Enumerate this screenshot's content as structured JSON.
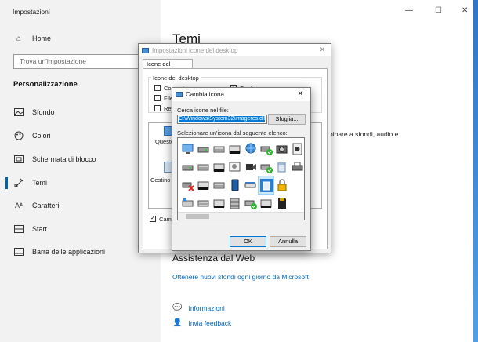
{
  "settings": {
    "app_title": "Impostazioni",
    "home_label": "Home",
    "search_placeholder": "Trova un'impostazione",
    "section_label": "Personalizzazione",
    "nav_items": [
      {
        "label": "Sfondo",
        "icon": "image-icon"
      },
      {
        "label": "Colori",
        "icon": "palette-icon"
      },
      {
        "label": "Schermata di blocco",
        "icon": "lock-screen-icon"
      },
      {
        "label": "Temi",
        "icon": "themes-icon"
      },
      {
        "label": "Caratteri",
        "icon": "font-icon"
      },
      {
        "label": "Start",
        "icon": "start-icon"
      },
      {
        "label": "Barra delle applicazioni",
        "icon": "taskbar-icon"
      }
    ],
    "active_item": "Temi",
    "main_title": "Temi",
    "partial_text": "binare a sfondi, audio e",
    "assistance_title": "Assistenza dal Web",
    "web_link": "Ottenere nuovi sfondi ogni giorno da Microsoft",
    "info_link": "Informazioni",
    "feedback_link": "Invia feedback",
    "partial_button": "ica"
  },
  "desktop_icons_dialog": {
    "title": "Impostazioni icone del desktop",
    "tab": "Icone del desktop",
    "group_label": "Icone del desktop",
    "checkboxes": [
      {
        "label": "Computer",
        "checked": false
      },
      {
        "label": "File",
        "checked": false
      },
      {
        "label": "Rete",
        "checked": false
      },
      {
        "label": "Cestino",
        "checked": true
      }
    ],
    "preview_labels": [
      "Questo",
      "Cestino ("
    ],
    "allow_themes_checkbox": {
      "label": "Cambia",
      "checked": true
    }
  },
  "change_icon_dialog": {
    "title": "Cambia icona",
    "file_label": "Cerca icone nel file:",
    "file_value": "C:\\Windows\\System32\\imageres.dll",
    "browse_button": "Sfoglia...",
    "list_label": "Selezionare un'icona dal seguente elenco:",
    "icon_names": [
      "monitor-icon",
      "drive-icon",
      "hdd-icon",
      "dvd-rw-icon",
      "globe-network-icon",
      "drive-check-icon",
      "camera-icon",
      "media-icon",
      "drive-icon",
      "hdd-icon",
      "dvd-r-icon",
      "photo-drive-icon",
      "camcorder-icon",
      "drive-green-check-icon",
      "trash-icon",
      "printer-icon",
      "drive-red-x-icon",
      "dvd-ram-icon",
      "hdd-icon",
      "phone-icon",
      "scanner-icon",
      "recycle-bin-full-icon",
      "padlock-icon",
      "empty-icon",
      "windows-drive-icon",
      "hdd-icon",
      "dvd-rom-icon",
      "hdd-stack-icon",
      "drive-green-check-icon",
      "dvd-icon",
      "sd-card-icon",
      "empty-icon"
    ],
    "selected_icon_index": 21,
    "ok_button": "OK",
    "cancel_button": "Annulla"
  }
}
